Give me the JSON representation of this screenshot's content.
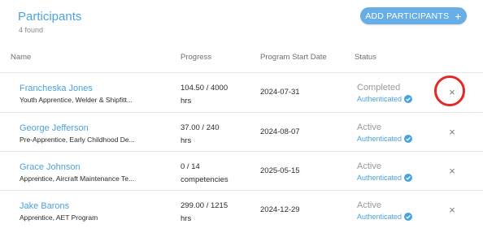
{
  "header": {
    "title": "Participants",
    "count_text": "4 found",
    "add_button_label": "ADD PARTICIPANTS",
    "add_button_icon": "+"
  },
  "columns": [
    "Name",
    "Progress",
    "Program Start Date",
    "Status"
  ],
  "rows": [
    {
      "name": "Francheska Jones",
      "program": "Youth Apprentice, Welder & Shipfitt...",
      "progress_line1": "104.50 / 4000",
      "progress_line2": "hrs",
      "start_date": "2024-07-31",
      "status": "Completed",
      "auth": "Authenticated"
    },
    {
      "name": "George Jefferson",
      "program": "Pre-Apprentice, Early Childhood De...",
      "progress_line1": "37.00 / 240",
      "progress_line2": "hrs",
      "start_date": "2024-08-07",
      "status": "Active",
      "auth": "Authenticated"
    },
    {
      "name": "Grace Johnson",
      "program": "Apprentice, Aircraft Maintenance Te...",
      "progress_line1": "0 / 14",
      "progress_line2": "competencies",
      "start_date": "2025-05-15",
      "status": "Active",
      "auth": "Authenticated"
    },
    {
      "name": "Jake Barons",
      "program": "Apprentice, AET Program",
      "progress_line1": "299.00 / 1215",
      "progress_line2": "hrs",
      "start_date": "2024-12-29",
      "status": "Active",
      "auth": "Authenticated"
    }
  ],
  "remove_icon": "×",
  "colors": {
    "accent": "#4aa3df",
    "button": "#67aee6",
    "highlight": "#e02a25"
  }
}
